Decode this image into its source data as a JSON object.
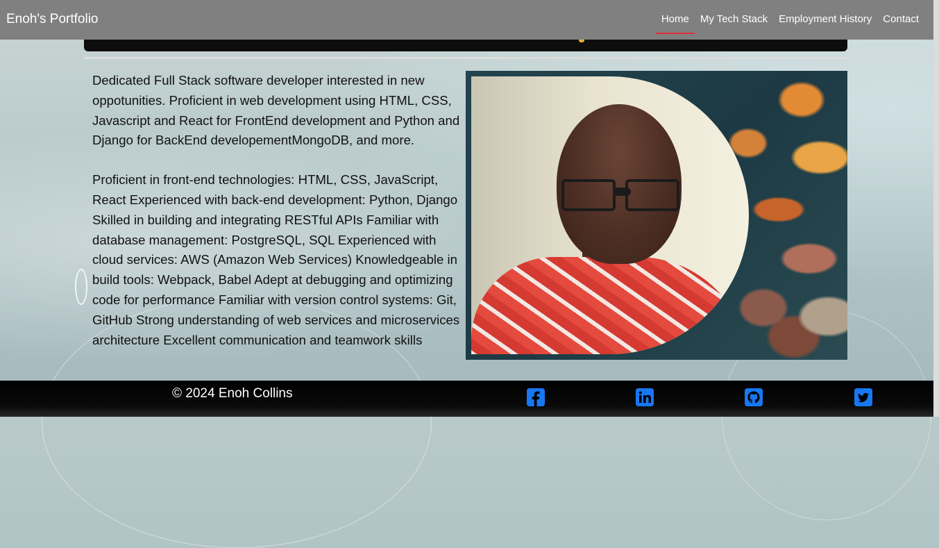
{
  "navbar": {
    "brand": "Enoh's Portfolio",
    "links": [
      {
        "label": "Home",
        "active": true
      },
      {
        "label": "My Tech Stack"
      },
      {
        "label": "Employment History"
      },
      {
        "label": "Contact"
      }
    ]
  },
  "about": {
    "paragraph1": "Dedicated Full Stack software developer interested in new oppotunities. Proficient in web development using HTML, CSS, Javascript and React for FrontEnd development and Python and Django for BackEnd developementMongoDB, and more.",
    "paragraph2": "Proficient in front-end technologies: HTML, CSS, JavaScript, React Experienced with back-end development: Python, Django Skilled in building and integrating RESTful APIs Familiar with database management: PostgreSQL, SQL Experienced with cloud services: AWS (Amazon Web Services) Knowledgeable in build tools: Webpack, Babel Adept at debugging and optimizing code for performance Familiar with version control systems: Git, GitHub Strong understanding of web services and microservices architecture Excellent communication and teamwork skills"
  },
  "footer": {
    "copyright": "© 2024 Enoh Collins",
    "social_icons": [
      "facebook-icon",
      "linkedin-icon",
      "github-icon",
      "twitter-icon"
    ]
  },
  "colors": {
    "navbar_bg": "#808080",
    "active_underline": "#e0313a",
    "social_icon": "#1877f2",
    "footer_bg": "#000000"
  }
}
